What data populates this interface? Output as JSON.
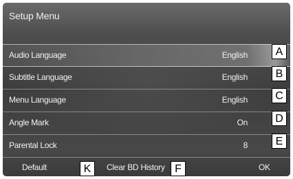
{
  "title": "Setup Menu",
  "rows": [
    {
      "label": "Audio Language",
      "value": "English",
      "callout": "A"
    },
    {
      "label": "Subtitle Language",
      "value": "English",
      "callout": "B"
    },
    {
      "label": "Menu Language",
      "value": "English",
      "callout": "C"
    },
    {
      "label": "Angle Mark",
      "value": "On",
      "callout": "D"
    },
    {
      "label": "Parental Lock",
      "value": "8",
      "callout": "E"
    }
  ],
  "bottom": {
    "default_label": "Default",
    "default_callout": "K",
    "clear_label": "Clear BD History",
    "clear_callout": "F",
    "ok_label": "OK"
  }
}
